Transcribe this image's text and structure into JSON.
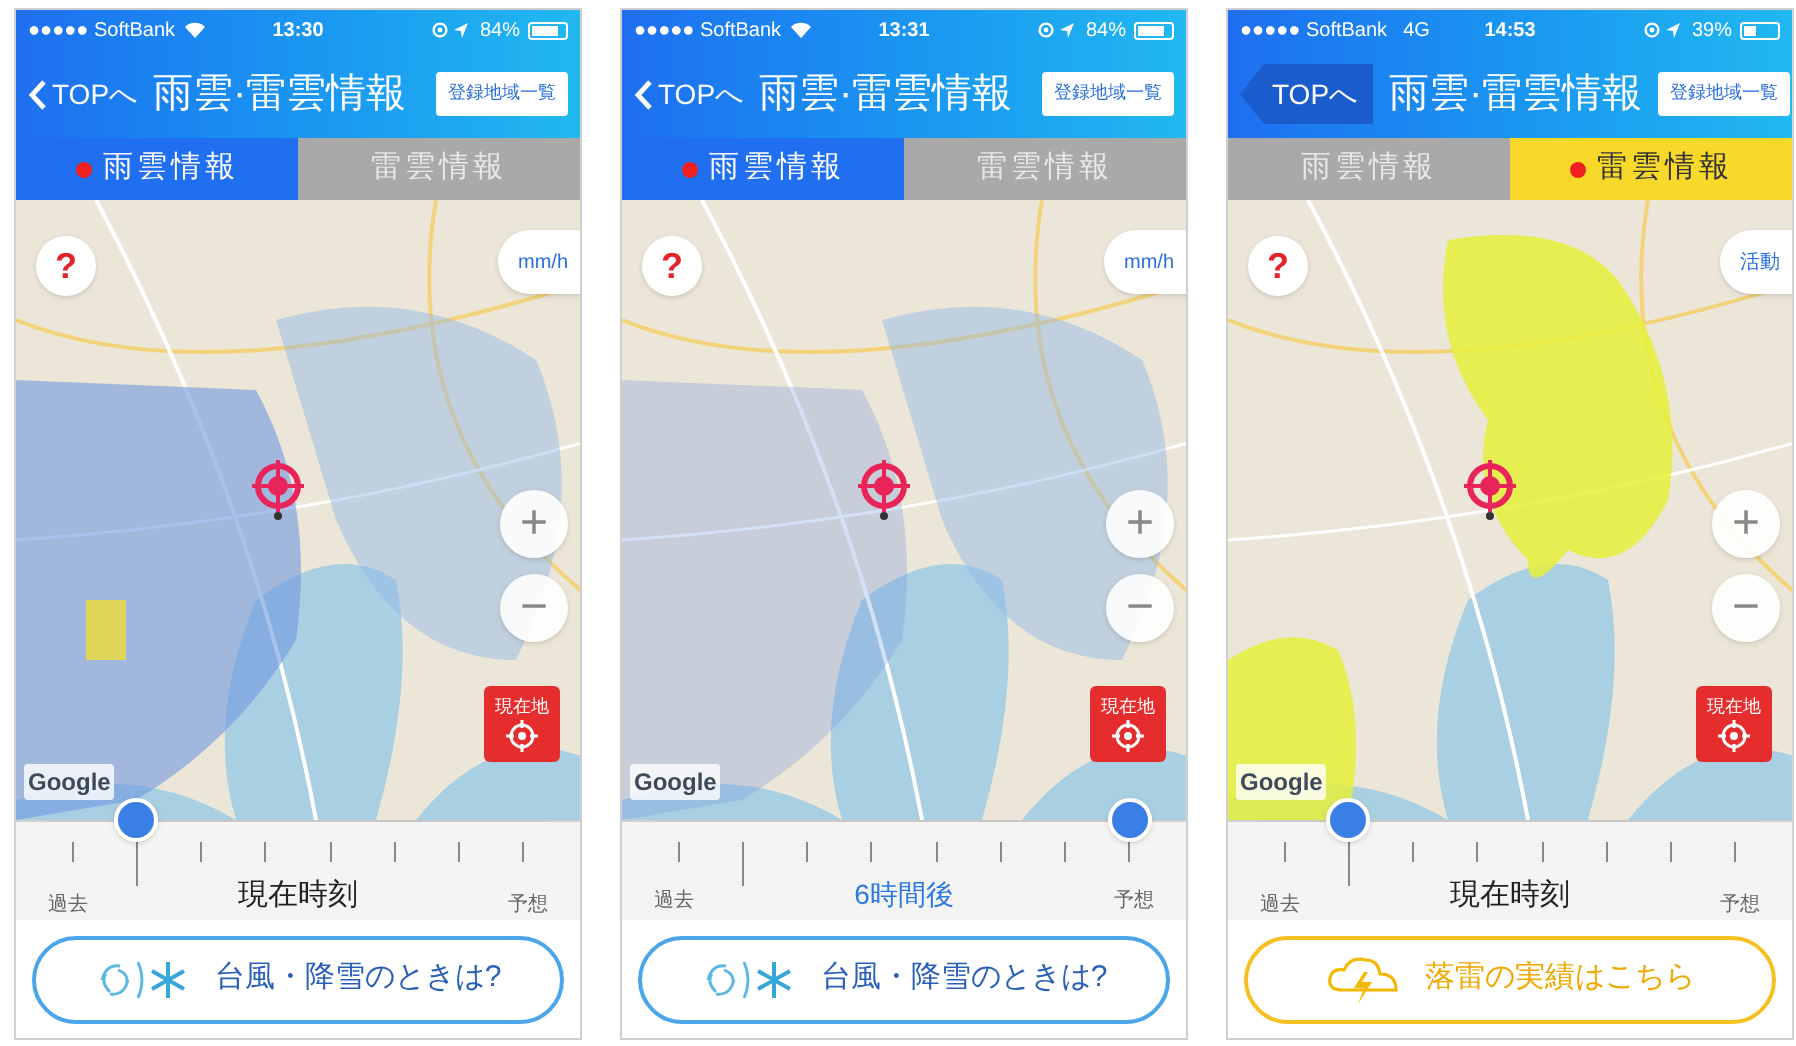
{
  "phones": [
    {
      "status_bar": {
        "carrier": "●●●●● SoftBank",
        "network": {
          "kind": "wifi"
        },
        "time": "13:30",
        "battery": "84%"
      },
      "nav": {
        "back": {
          "kind": "chevron",
          "label": "TOPへ"
        },
        "title": "雨雲·雷雲情報",
        "action": "登録地域一覧"
      },
      "kind": "rain",
      "tabs": [
        {
          "label": "雨雲情報",
          "selected": true
        },
        {
          "label": "雷雲情報",
          "selected": false
        }
      ],
      "map": {
        "help": "?",
        "unit_button": "mm/h",
        "zoom_in": "+",
        "zoom_out": "−",
        "locate_button": "現在地",
        "attribution": "Google"
      },
      "timeline": {
        "start": "過去",
        "current": "現在時刻",
        "highlighted": false,
        "end": "予想",
        "level": 0.143
      },
      "banner": {
        "kind": "typhoon",
        "label": "台風・降雪のときは?"
      }
    },
    {
      "status_bar": {
        "carrier": "●●●●● SoftBank",
        "network": {
          "kind": "wifi"
        },
        "time": "13:31",
        "battery": "84%"
      },
      "nav": {
        "back": {
          "kind": "chevron",
          "label": "TOPへ"
        },
        "title": "雨雲·雷雲情報",
        "action": "登録地域一覧"
      },
      "kind": "rain",
      "tabs": [
        {
          "label": "雨雲情報",
          "selected": true
        },
        {
          "label": "雷雲情報",
          "selected": false
        }
      ],
      "map": {
        "help": "?",
        "unit_button": "mm/h",
        "zoom_in": "+",
        "zoom_out": "−",
        "locate_button": "現在地",
        "attribution": "Google"
      },
      "timeline": {
        "start": "過去",
        "current": "6時間後",
        "highlighted": true,
        "end": "予想",
        "level": 1
      },
      "banner": {
        "kind": "typhoon",
        "label": "台風・降雪のときは?"
      }
    },
    {
      "status_bar": {
        "carrier": "●●●●● SoftBank",
        "network": {
          "kind": "text",
          "label": "4G"
        },
        "time": "14:53",
        "battery": "39%"
      },
      "nav": {
        "back": {
          "kind": "tab",
          "label": "TOPへ"
        },
        "title": "雨雲·雷雲情報",
        "action": "登録地域一覧"
      },
      "kind": "thunder",
      "tabs": [
        {
          "label": "雨雲情報",
          "selected": false
        },
        {
          "label": "雷雲情報",
          "selected": true
        }
      ],
      "map": {
        "help": "?",
        "unit_button": "活動",
        "zoom_in": "+",
        "zoom_out": "−",
        "locate_button": "現在地",
        "attribution": "Google"
      },
      "timeline": {
        "start": "過去",
        "current": "現在時刻",
        "highlighted": false,
        "end": "予想",
        "level": 0.143
      },
      "banner": {
        "kind": "lightning",
        "label": "落雷の実績はこちら"
      }
    }
  ]
}
